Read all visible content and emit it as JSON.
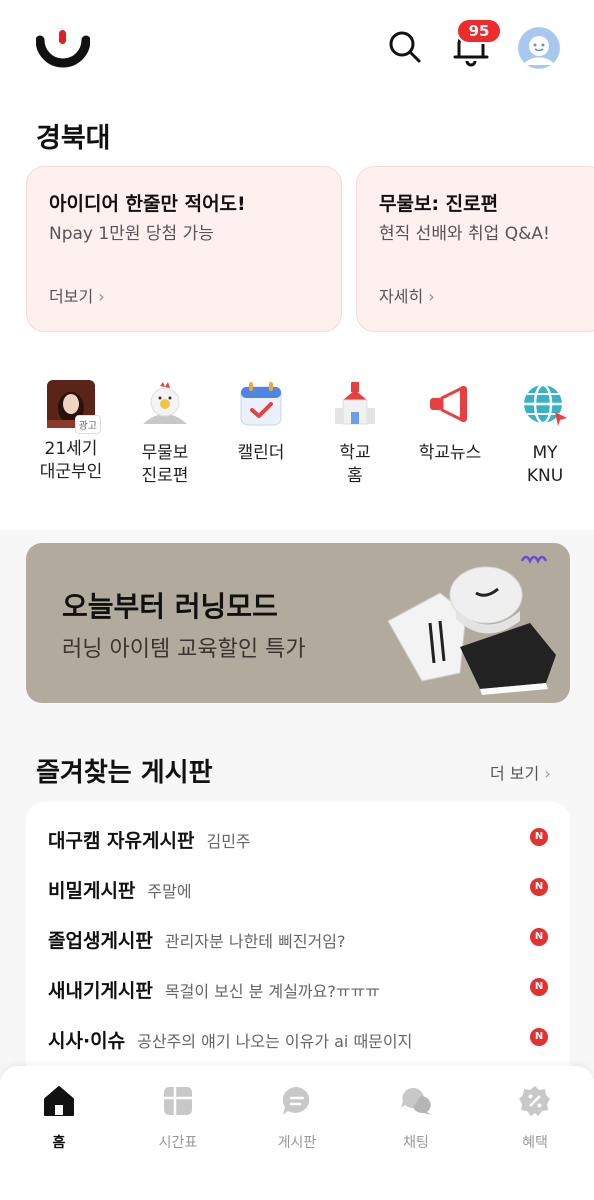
{
  "header": {
    "logo": "everytime-logo",
    "notification_count": "95",
    "icons": [
      "search-icon",
      "bell-icon",
      "avatar"
    ]
  },
  "school": {
    "name": "경북대"
  },
  "promos": [
    {
      "title": "아이디어 한줄만 적어도!",
      "subtitle": "Npay 1만원 당첨 가능",
      "link": "더보기"
    },
    {
      "title": "무물보: 진로편",
      "subtitle": "현직 선배와 취업 Q&A!",
      "link": "자세히"
    }
  ],
  "shortcuts": [
    {
      "label": "21세기\n대군부인",
      "ad": "광고",
      "icon": "drama-poster"
    },
    {
      "label": "무물보\n진로편",
      "icon": "chicken-icon"
    },
    {
      "label": "캘린더",
      "icon": "calendar-icon"
    },
    {
      "label": "학교\n홈",
      "icon": "school-icon"
    },
    {
      "label": "학교뉴스",
      "icon": "megaphone-icon"
    },
    {
      "label": "MY\nKNU",
      "icon": "globe-icon"
    }
  ],
  "banner": {
    "title": "오늘부터 러닝모드",
    "subtitle": "러닝 아이템 교육할인 특가"
  },
  "favorites": {
    "title": "즐겨찾는 게시판",
    "more": "더 보기",
    "new_badge": "N",
    "boards": [
      {
        "name": "대구캠 자유게시판",
        "post": "김민주"
      },
      {
        "name": "비밀게시판",
        "post": "주말에"
      },
      {
        "name": "졸업생게시판",
        "post": "관리자분 나한테 삐진거임?"
      },
      {
        "name": "새내기게시판",
        "post": "목걸이 보신 분 계실까요?ㅠㅠㅠ"
      },
      {
        "name": "시사·이슈",
        "post": "공산주의 얘기 나오는 이유가 ai 때문이지"
      }
    ]
  },
  "tabs": [
    {
      "label": "홈",
      "icon": "home-icon",
      "active": true
    },
    {
      "label": "시간표",
      "icon": "timetable-icon"
    },
    {
      "label": "게시판",
      "icon": "board-icon"
    },
    {
      "label": "채팅",
      "icon": "chat-icon"
    },
    {
      "label": "혜택",
      "icon": "benefit-icon"
    }
  ],
  "colors": {
    "accent": "#ee2a2a",
    "promo_bg": "#fff0f0",
    "banner_bg": "#b3aa9e"
  }
}
